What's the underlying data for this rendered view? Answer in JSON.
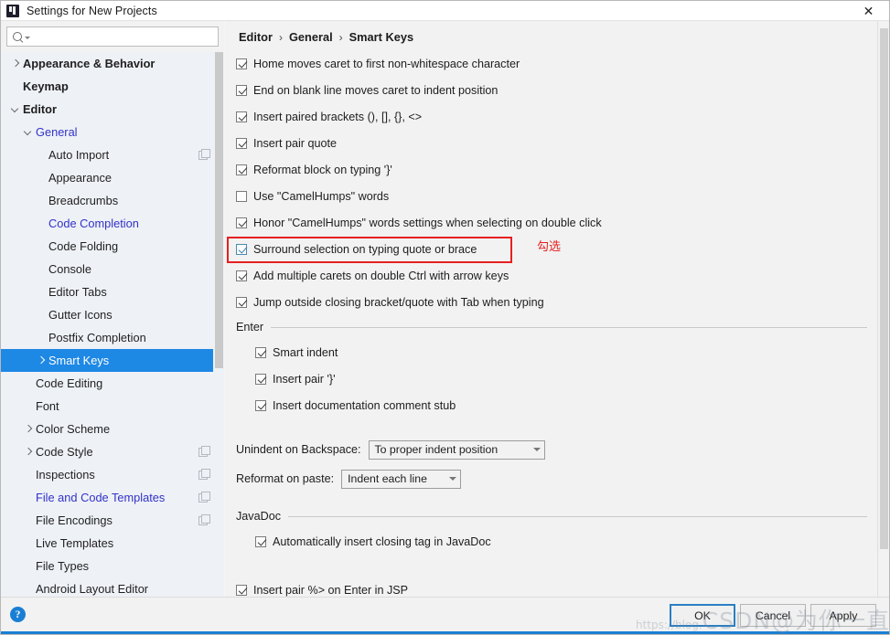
{
  "window": {
    "title": "Settings for New Projects",
    "close_label": "✕",
    "app_icon": "intellij-idea-icon"
  },
  "search": {
    "value": "",
    "placeholder": "",
    "icon": "search-icon",
    "dropdown_icon": "chevron-down-icon"
  },
  "sidebar": {
    "scroll_position": "top",
    "items": [
      {
        "label": "Appearance & Behavior",
        "level": 0,
        "arrow": "collapsed",
        "style": "bold",
        "copy": false
      },
      {
        "label": "Keymap",
        "level": 0,
        "arrow": "none",
        "style": "bold",
        "copy": false
      },
      {
        "label": "Editor",
        "level": 0,
        "arrow": "expanded",
        "style": "bold",
        "copy": false
      },
      {
        "label": "General",
        "level": 1,
        "arrow": "expanded",
        "style": "blue",
        "copy": false
      },
      {
        "label": "Auto Import",
        "level": 2,
        "arrow": "none",
        "style": "normal",
        "copy": true
      },
      {
        "label": "Appearance",
        "level": 2,
        "arrow": "none",
        "style": "normal",
        "copy": false
      },
      {
        "label": "Breadcrumbs",
        "level": 2,
        "arrow": "none",
        "style": "normal",
        "copy": false
      },
      {
        "label": "Code Completion",
        "level": 2,
        "arrow": "none",
        "style": "blue",
        "copy": false
      },
      {
        "label": "Code Folding",
        "level": 2,
        "arrow": "none",
        "style": "normal",
        "copy": false
      },
      {
        "label": "Console",
        "level": 2,
        "arrow": "none",
        "style": "normal",
        "copy": false
      },
      {
        "label": "Editor Tabs",
        "level": 2,
        "arrow": "none",
        "style": "normal",
        "copy": false
      },
      {
        "label": "Gutter Icons",
        "level": 2,
        "arrow": "none",
        "style": "normal",
        "copy": false
      },
      {
        "label": "Postfix Completion",
        "level": 2,
        "arrow": "none",
        "style": "normal",
        "copy": false
      },
      {
        "label": "Smart Keys",
        "level": 2,
        "arrow": "collapsed",
        "style": "selected",
        "copy": false
      },
      {
        "label": "Code Editing",
        "level": 1,
        "arrow": "none",
        "style": "normal",
        "copy": false
      },
      {
        "label": "Font",
        "level": 1,
        "arrow": "none",
        "style": "normal",
        "copy": false
      },
      {
        "label": "Color Scheme",
        "level": 1,
        "arrow": "collapsed",
        "style": "normal",
        "copy": false
      },
      {
        "label": "Code Style",
        "level": 1,
        "arrow": "collapsed",
        "style": "normal",
        "copy": true
      },
      {
        "label": "Inspections",
        "level": 1,
        "arrow": "none",
        "style": "normal",
        "copy": true
      },
      {
        "label": "File and Code Templates",
        "level": 1,
        "arrow": "none",
        "style": "blue",
        "copy": true
      },
      {
        "label": "File Encodings",
        "level": 1,
        "arrow": "none",
        "style": "normal",
        "copy": true
      },
      {
        "label": "Live Templates",
        "level": 1,
        "arrow": "none",
        "style": "normal",
        "copy": false
      },
      {
        "label": "File Types",
        "level": 1,
        "arrow": "none",
        "style": "normal",
        "copy": false
      },
      {
        "label": "Android Layout Editor",
        "level": 1,
        "arrow": "none",
        "style": "normal",
        "copy": false
      }
    ]
  },
  "breadcrumb": {
    "separator": "›",
    "parts": [
      "Editor",
      "General",
      "Smart Keys"
    ]
  },
  "main": {
    "top_checkboxes": [
      {
        "label": "Home moves caret to first non-whitespace character",
        "checked": true
      },
      {
        "label": "End on blank line moves caret to indent position",
        "checked": true
      },
      {
        "label": "Insert paired brackets (), [], {}, <>",
        "checked": true
      },
      {
        "label": "Insert pair quote",
        "checked": true
      },
      {
        "label": "Reformat block on typing '}'",
        "checked": true
      },
      {
        "label": "Use \"CamelHumps\" words",
        "checked": false
      },
      {
        "label": "Honor \"CamelHumps\" words settings when selecting on double click",
        "checked": true
      },
      {
        "label": "Surround selection on typing quote or brace",
        "checked": true,
        "highlighted": true
      },
      {
        "label": "Add multiple carets on double Ctrl with arrow keys",
        "checked": true
      },
      {
        "label": "Jump outside closing bracket/quote with Tab when typing",
        "checked": true
      }
    ],
    "enter_section": {
      "title": "Enter",
      "checkboxes": [
        {
          "label": "Smart indent",
          "checked": true
        },
        {
          "label": "Insert pair '}'",
          "checked": true
        },
        {
          "label": "Insert documentation comment stub",
          "checked": true
        }
      ]
    },
    "fields": [
      {
        "label": "Unindent on Backspace:",
        "value": "To proper indent position",
        "width": "w1"
      },
      {
        "label": "Reformat on paste:",
        "value": "Indent each line",
        "width": "w2"
      }
    ],
    "javadoc_section": {
      "title": "JavaDoc",
      "checkboxes": [
        {
          "label": "Automatically insert closing tag in JavaDoc",
          "checked": true
        }
      ]
    },
    "bottom_checkboxes": [
      {
        "label": "Insert pair %> on Enter in JSP",
        "checked": true
      }
    ]
  },
  "annotation": {
    "text": "勾选",
    "color": "#e62020"
  },
  "footer": {
    "help_label": "?",
    "buttons": [
      {
        "label": "OK",
        "primary": true
      },
      {
        "label": "Cancel",
        "primary": false
      },
      {
        "label": "Apply",
        "primary": false
      }
    ]
  },
  "watermark": {
    "prefix": "https://blog.",
    "brand": "CSDN",
    "suffix": "@为你一直存在"
  }
}
